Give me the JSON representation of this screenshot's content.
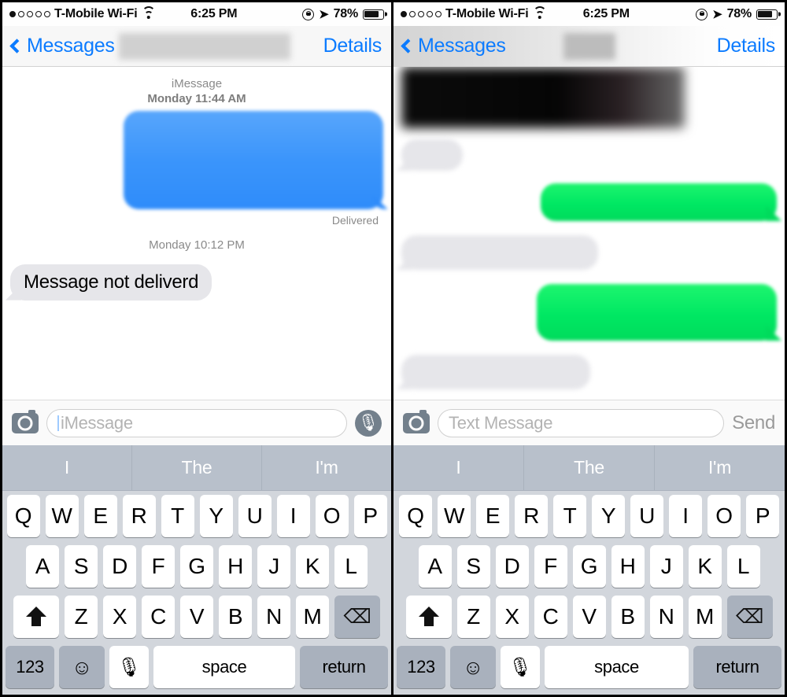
{
  "status_bar": {
    "signal_dots_filled": 1,
    "signal_dots_total": 5,
    "carrier": "T-Mobile Wi-Fi",
    "wifi_icon": "wifi-icon",
    "time": "6:25 PM",
    "rotation_lock_icon": "rotation-lock-icon",
    "location_icon": "location-arrow-icon",
    "battery_percent": "78%",
    "battery_icon": "battery-icon"
  },
  "nav": {
    "back_label": "Messages",
    "back_icon": "chevron-left-icon",
    "details_label": "Details",
    "title_redacted": true
  },
  "left_panel": {
    "conversation": {
      "service_label": "iMessage",
      "first_timestamp": "Monday 11:44 AM",
      "second_timestamp": "Monday 10:12 PM",
      "delivered_label": "Delivered",
      "messages": [
        {
          "side": "outgoing",
          "style": "blue",
          "text": "",
          "redacted": true
        },
        {
          "side": "incoming",
          "style": "gray",
          "text": "Message not deliverd",
          "redacted": false
        }
      ]
    },
    "input": {
      "camera_icon": "camera-icon",
      "placeholder": "iMessage",
      "action_icon": "microphone-icon",
      "action_label": ""
    }
  },
  "right_panel": {
    "conversation": {
      "messages": [
        {
          "side": "incoming",
          "style": "redact-bar",
          "text": "",
          "redacted": true
        },
        {
          "side": "incoming",
          "style": "gray",
          "text": "",
          "redacted": true
        },
        {
          "side": "outgoing",
          "style": "green",
          "text": "",
          "redacted": true
        },
        {
          "side": "incoming",
          "style": "gray",
          "text": "",
          "redacted": true
        },
        {
          "side": "outgoing",
          "style": "green",
          "text": "",
          "redacted": true
        },
        {
          "side": "incoming",
          "style": "gray",
          "text": "",
          "redacted": true
        }
      ]
    },
    "input": {
      "camera_icon": "camera-icon",
      "placeholder": "Text Message",
      "action_icon": "",
      "action_label": "Send"
    }
  },
  "keyboard": {
    "predictions": [
      "I",
      "The",
      "I'm"
    ],
    "row1": [
      "Q",
      "W",
      "E",
      "R",
      "T",
      "Y",
      "U",
      "I",
      "O",
      "P"
    ],
    "row2": [
      "A",
      "S",
      "D",
      "F",
      "G",
      "H",
      "J",
      "K",
      "L"
    ],
    "row3": [
      "Z",
      "X",
      "C",
      "V",
      "B",
      "N",
      "M"
    ],
    "shift_icon": "shift-arrow-icon",
    "backspace_icon": "backspace-icon",
    "backspace_glyph": "⌫",
    "numbers_label": "123",
    "emoji_icon": "emoji-smiley-icon",
    "emoji_glyph": "☺",
    "dictation_icon": "microphone-icon",
    "dictation_glyph": "Ψ",
    "space_label": "space",
    "return_label": "return"
  },
  "colors": {
    "imessage_blue": "#3b95fb",
    "sms_green": "#00e863",
    "received_gray": "#e6e6ea",
    "link_blue": "#0b7bff",
    "keyboard_bg": "#d2d6dc",
    "predictive_bg": "#b8c0cb"
  }
}
